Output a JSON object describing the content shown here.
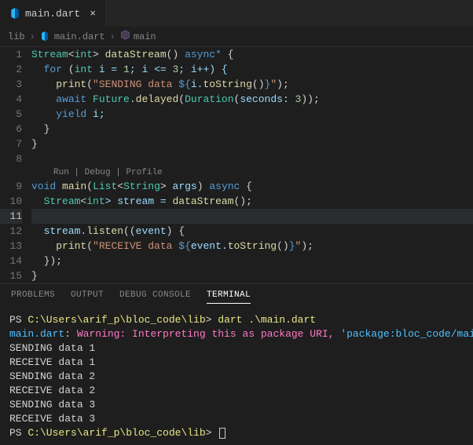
{
  "tab": {
    "label": "main.dart"
  },
  "breadcrumb": {
    "root": "lib",
    "file": "main.dart",
    "symbol": "main"
  },
  "codelens": {
    "run": "Run",
    "debug": "Debug",
    "profile": "Profile",
    "sep": " | "
  },
  "gutter": [
    "1",
    "2",
    "3",
    "4",
    "5",
    "6",
    "7",
    "8",
    "",
    "9",
    "10",
    "11",
    "12",
    "13",
    "14",
    "15"
  ],
  "code": {
    "l1": {
      "a": "Stream",
      "b": "<",
      "c": "int",
      "d": "> ",
      "e": "dataStream",
      "f": "() ",
      "g": "async*",
      "h": " {"
    },
    "l2": {
      "a": "  ",
      "b": "for",
      "c": " (",
      "d": "int",
      "e": " i = ",
      "f": "1",
      "g": "; i <= ",
      "h": "3",
      "i": "; i++) {"
    },
    "l3": {
      "a": "    ",
      "b": "print",
      "c": "(",
      "d": "\"SENDING data ",
      "e": "${",
      "f": "i.",
      "g": "toString",
      "h": "()",
      "i": "}",
      "j": "\"",
      "k": ");"
    },
    "l4": {
      "a": "    ",
      "b": "await",
      "c": " ",
      "d": "Future",
      "e": ".",
      "f": "delayed",
      "g": "(",
      "h": "Duration",
      "i": "(",
      "j": "seconds",
      "k": ": ",
      "l": "3",
      "m": "));"
    },
    "l5": {
      "a": "    ",
      "b": "yield",
      "c": " i;"
    },
    "l6": {
      "a": "  }"
    },
    "l7": {
      "a": "}"
    },
    "l8": {
      "a": ""
    },
    "l9": {
      "a": "void",
      "b": " ",
      "c": "main",
      "d": "(",
      "e": "List",
      "f": "<",
      "g": "String",
      "h": "> ",
      "i": "args",
      "j": ") ",
      "k": "async",
      "l": " {"
    },
    "l10": {
      "a": "  ",
      "b": "Stream",
      "c": "<",
      "d": "int",
      "e": "> stream = ",
      "f": "dataStream",
      "g": "();"
    },
    "l11": {
      "a": "  "
    },
    "l12": {
      "a": "  stream.",
      "b": "listen",
      "c": "((",
      "d": "event",
      "e": ") {"
    },
    "l13": {
      "a": "    ",
      "b": "print",
      "c": "(",
      "d": "\"RECEIVE data ",
      "e": "${",
      "f": "event.",
      "g": "toString",
      "h": "()",
      "i": "}",
      "j": "\"",
      "k": ");"
    },
    "l14": {
      "a": "  });"
    },
    "l15": {
      "a": "}"
    }
  },
  "panel": {
    "problems": "PROBLEMS",
    "output": "OUTPUT",
    "debug": "DEBUG CONSOLE",
    "terminal": "TERMINAL"
  },
  "terminal": {
    "t1": {
      "a": "PS ",
      "b": "C:\\Users\\arif_p\\bloc_code\\lib",
      "c": "> ",
      "d": "dart .\\main.dart"
    },
    "t2": {
      "a": "main.dart",
      "b": ": ",
      "c": "Warning: Interpreting this as package URI, ",
      "d": "'package:bloc_code/main.dart'",
      "e": "."
    },
    "t3": "SENDING data 1",
    "t4": "RECEIVE data 1",
    "t5": "SENDING data 2",
    "t6": "RECEIVE data 2",
    "t7": "SENDING data 3",
    "t8": "RECEIVE data 3",
    "t9": {
      "a": "PS ",
      "b": "C:\\Users\\arif_p\\bloc_code\\lib",
      "c": "> "
    }
  }
}
